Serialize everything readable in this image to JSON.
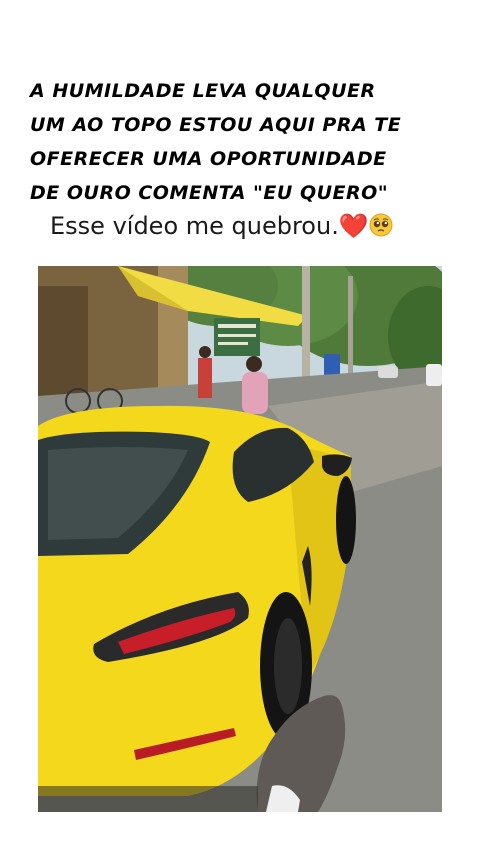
{
  "headline_lines": [
    "A HUMILDADE LEVA QUALQUER",
    "UM AO TOPO ESTOU AQUI PRA TE",
    "OFERECER UMA OPORTUNIDADE",
    "DE OURO COMENTA \"EU QUERO\""
  ],
  "caption": {
    "text": "Esse vídeo me quebrou.",
    "emoji_heart": "❤️",
    "emoji_face": "pleading-face-icon"
  },
  "photo": {
    "description_icon": "yellow-sports-car-photo",
    "colors": {
      "car": "#f3d81c",
      "road": "#8c8c86",
      "trees": "#4f7a3a",
      "awning": "#f1dc43",
      "sky": "#c9d8df"
    }
  }
}
